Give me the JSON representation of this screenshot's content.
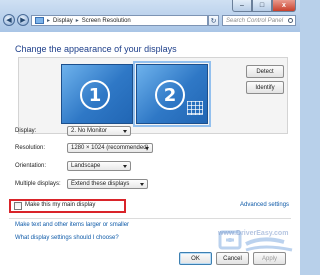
{
  "window": {
    "caption_minimize": "–",
    "caption_maximize": "□",
    "caption_close": "x"
  },
  "navigation": {
    "back_icon": "arrow-left",
    "forward_icon": "arrow-right",
    "breadcrumb_sep": "▸",
    "breadcrumb": [
      "Display",
      "Screen Resolution"
    ],
    "refresh_icon": "refresh",
    "search_placeholder": "Search Control Panel"
  },
  "page": {
    "heading": "Change the appearance of your displays"
  },
  "monitors": [
    {
      "number": "1"
    },
    {
      "number": "2",
      "selected": true
    }
  ],
  "buttons": {
    "detect": "Detect",
    "identify": "Identify",
    "ok": "OK",
    "cancel": "Cancel",
    "apply": "Apply"
  },
  "settings": {
    "display": {
      "label": "Display:",
      "value": "2. No Monitor"
    },
    "resolution": {
      "label": "Resolution:",
      "value": "1280 × 1024 (recommended)"
    },
    "orientation": {
      "label": "Orientation:",
      "value": "Landscape"
    },
    "multiple_displays": {
      "label": "Multiple displays:",
      "value": "Extend these displays"
    }
  },
  "main_display": {
    "label": "Make this my main display",
    "checked": false
  },
  "links": {
    "advanced_settings": "Advanced settings",
    "text_larger": "Make text and other items larger or smaller",
    "what_settings": "What display settings should I choose?"
  },
  "watermark": {
    "text": "driver easy",
    "url": "www.DriverEasy.com"
  },
  "colors": {
    "accent": "#1e3f8a",
    "link": "#0e5aa8",
    "highlight_box": "#d9242a",
    "monitor_blue": "#2f78c6"
  }
}
